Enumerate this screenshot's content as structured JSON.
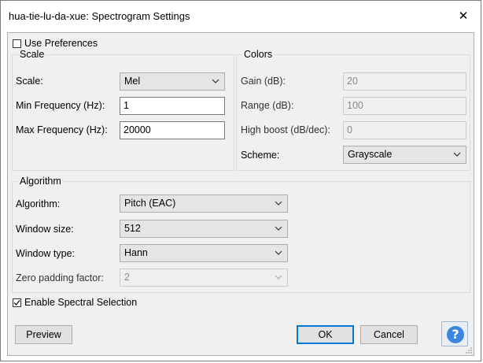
{
  "window": {
    "title": "hua-tie-lu-da-xue: Spectrogram Settings",
    "close_glyph": "✕"
  },
  "use_preferences": {
    "label": "Use Preferences",
    "checked": false
  },
  "scale": {
    "group_title": "Scale",
    "scale_label": "Scale:",
    "scale_value": "Mel",
    "min_freq_label": "Min Frequency (Hz):",
    "min_freq_value": "1",
    "max_freq_label": "Max Frequency (Hz):",
    "max_freq_value": "20000"
  },
  "colors": {
    "group_title": "Colors",
    "gain_label": "Gain (dB):",
    "gain_value": "20",
    "range_label": "Range (dB):",
    "range_value": "100",
    "high_boost_label": "High boost (dB/dec):",
    "high_boost_value": "0",
    "scheme_label": "Scheme:",
    "scheme_value": "Grayscale"
  },
  "algorithm": {
    "group_title": "Algorithm",
    "algorithm_label": "Algorithm:",
    "algorithm_value": "Pitch (EAC)",
    "window_size_label": "Window size:",
    "window_size_value": "512",
    "window_type_label": "Window type:",
    "window_type_value": "Hann",
    "zero_padding_label": "Zero padding factor:",
    "zero_padding_value": "2"
  },
  "spectral_selection": {
    "label": "Enable Spectral Selection",
    "checked": true
  },
  "buttons": {
    "preview": "Preview",
    "ok": "OK",
    "cancel": "Cancel",
    "help": "?"
  },
  "colors_theme": {
    "accent": "#0078d7",
    "help_blue": "#3a86e0",
    "dialog_bg": "#f0f0f0"
  }
}
